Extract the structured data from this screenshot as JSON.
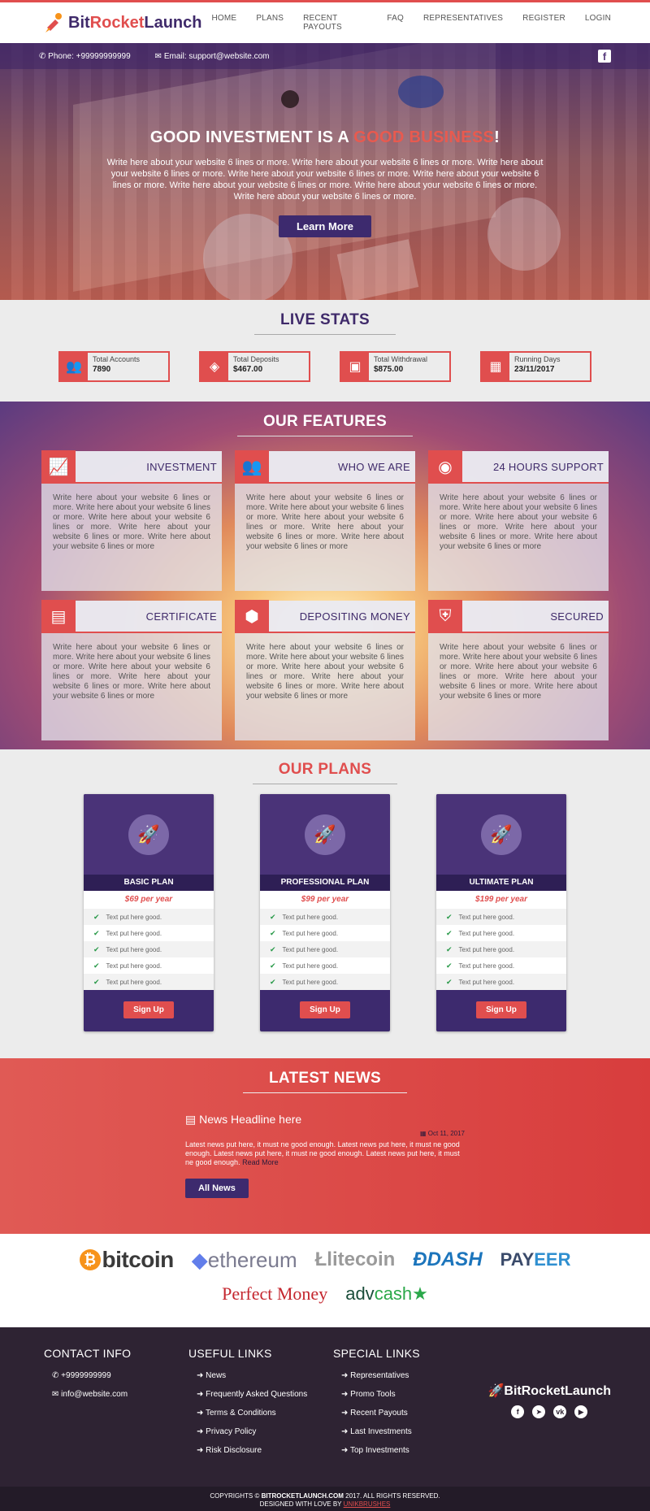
{
  "colors": {
    "accent": "#e04e4e",
    "primary": "#3d2a6e"
  },
  "header": {
    "logo_part1": "Bit",
    "logo_part2": "Rocket",
    "logo_part3": "Launch",
    "nav": [
      "HOME",
      "PLANS",
      "RECENT PAYOUTS",
      "FAQ",
      "REPRESENTATIVES",
      "REGISTER",
      "LOGIN"
    ]
  },
  "contact": {
    "phone": "Phone: +99999999999",
    "email": "Email: support@website.com"
  },
  "hero": {
    "title_part1": "GOOD INVESTMENT IS A ",
    "title_accent": "GOOD BUSINESS",
    "title_end": "!",
    "text": "Write here about your website 6 lines or more. Write here about your website 6 lines or more. Write here about your website 6 lines or more. Write here about your website 6 lines or more. Write here about your website 6 lines or more. Write here about your website 6 lines or more. Write here about your website 6 lines or more. Write here about your website 6 lines or more.",
    "button": "Learn More"
  },
  "live": {
    "title": "LIVE STATS",
    "stats": [
      {
        "label": "Total Accounts",
        "value": "7890",
        "icon": "users-icon"
      },
      {
        "label": "Total Deposits",
        "value": "$467.00",
        "icon": "coins-icon"
      },
      {
        "label": "Total Withdrawal",
        "value": "$875.00",
        "icon": "money-icon"
      },
      {
        "label": "Running Days",
        "value": "23/11/2017",
        "icon": "calendar-icon"
      }
    ]
  },
  "features": {
    "title": "OUR FEATURES",
    "items": [
      {
        "title": "INVESTMENT",
        "icon": "chart-icon",
        "text": "Write here about your website 6 lines or more. Write here about your website 6 lines or more. Write here about your website 6 lines or more. Write here about your website 6 lines or more. Write here about your website 6 lines or more"
      },
      {
        "title": "WHO WE ARE",
        "icon": "team-icon",
        "text": "Write here about your website 6 lines or more. Write here about your website 6 lines or more. Write here about your website 6 lines or more. Write here about your website 6 lines or more. Write here about your website 6 lines or more"
      },
      {
        "title": "24 HOURS SUPPORT",
        "icon": "user-icon",
        "text": "Write here about your website 6 lines or more. Write here about your website 6 lines or more. Write here about your website 6 lines or more. Write here about your website 6 lines or more. Write here about your website 6 lines or more"
      },
      {
        "title": "CERTIFICATE",
        "icon": "certificate-icon",
        "text": "Write here about your website 6 lines or more. Write here about your website 6 lines or more. Write here about your website 6 lines or more. Write here about your website 6 lines or more. Write here about your website 6 lines or more"
      },
      {
        "title": "DEPOSITING MONEY",
        "icon": "cubes-icon",
        "text": "Write here about your website 6 lines or more. Write here about your website 6 lines or more. Write here about your website 6 lines or more. Write here about your website 6 lines or more. Write here about your website 6 lines or more"
      },
      {
        "title": "SECURED",
        "icon": "shield-icon",
        "text": "Write here about your website 6 lines or more. Write here about your website 6 lines or more. Write here about your website 6 lines or more. Write here about your website 6 lines or more. Write here about your website 6 lines or more"
      }
    ]
  },
  "plans": {
    "title": "OUR PLANS",
    "items": [
      {
        "name": "BASIC PLAN",
        "price": "$69 per year",
        "features": [
          "Text put here good.",
          "Text put here good.",
          "Text put here good.",
          "Text put here good.",
          "Text put here good."
        ],
        "button": "Sign Up"
      },
      {
        "name": "PROFESSIONAL PLAN",
        "price": "$99 per year",
        "features": [
          "Text put here good.",
          "Text put here good.",
          "Text put here good.",
          "Text put here good.",
          "Text put here good."
        ],
        "button": "Sign Up"
      },
      {
        "name": "ULTIMATE PLAN",
        "price": "$199 per year",
        "features": [
          "Text put here good.",
          "Text put here good.",
          "Text put here good.",
          "Text put here good.",
          "Text put here good."
        ],
        "button": "Sign Up"
      }
    ]
  },
  "news": {
    "title": "LATEST NEWS",
    "headline": "News Headline here",
    "date": "Oct 11, 2017",
    "text": "Latest news put here, it must ne good enough. Latest news put here, it must ne good enough. Latest news put here, it must ne good enough. Latest news put here, it must ne good enough.",
    "read_more": "Read More",
    "button": "All News"
  },
  "payments": {
    "bitcoin": "bitcoin",
    "ethereum": "ethereum",
    "litecoin": "litecoin",
    "dash": "DASH",
    "payeer_part1": "PAY",
    "payeer_part2": "EER",
    "perfect_money": "Perfect Money",
    "advcash_part1": "adv",
    "advcash_part2": "cash"
  },
  "footer": {
    "contact_title": "CONTACT INFO",
    "phone": "+9999999999",
    "email": "info@website.com",
    "useful_title": "USEFUL LINKS",
    "useful": [
      "News",
      "Frequently Asked Questions",
      "Terms & Conditions",
      "Privacy Policy",
      "Risk Disclosure"
    ],
    "special_title": "SPECIAL LINKS",
    "special": [
      "Representatives",
      "Promo Tools",
      "Recent Payouts",
      "Last Investments",
      "Top Investments"
    ],
    "logo": "BitRocketLaunch",
    "copyright_pre": "COPYRIGHTS © ",
    "copyright_brand": "BITROCKETLAUNCH.COM",
    "copyright_post": " 2017. ALL RIGHTS RESERVED.",
    "designed_pre": "DESIGNED WITH LOVE BY ",
    "designed_by": "UNIKBRUSHES"
  }
}
